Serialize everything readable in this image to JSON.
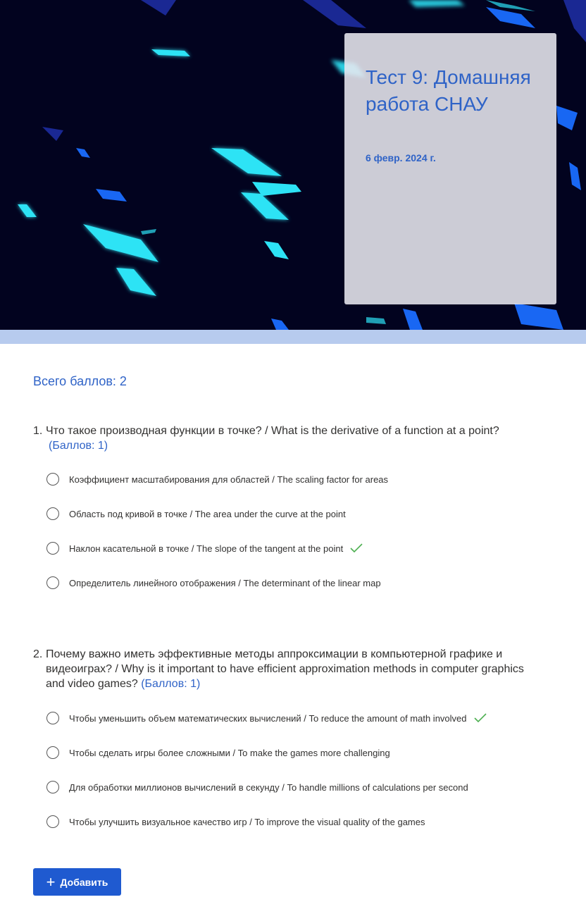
{
  "header": {
    "title": "Тест 9: Домашняя работа СНАУ",
    "date": "6 февр. 2024 г."
  },
  "total_points": "Всего баллов: 2",
  "questions": [
    {
      "number": "1.",
      "text": "Что такое производная функции в точке? / What is the derivative of a function at a point?",
      "points": "(Баллов: 1)",
      "options": [
        {
          "label": "Коэффициент масштабирования для областей / The scaling factor for areas",
          "correct": false
        },
        {
          "label": "Область под кривой в точке / The area under the curve at the point",
          "correct": false
        },
        {
          "label": "Наклон касательной в точке / The slope of the tangent at the point",
          "correct": true
        },
        {
          "label": "Определитель линейного отображения / The determinant of the linear map",
          "correct": false
        }
      ]
    },
    {
      "number": "2.",
      "text": "Почему важно иметь эффективные методы аппроксимации в компьютерной графике и видеоиграх? / Why is it important to have efficient approximation methods in computer graphics and video games?",
      "points": "(Баллов: 1)",
      "options": [
        {
          "label": "Чтобы уменьшить объем математических вычислений / To reduce the amount of math involved",
          "correct": true
        },
        {
          "label": "Чтобы сделать игры более сложными / To make the games more challenging",
          "correct": false
        },
        {
          "label": "Для обработки миллионов вычислений в секунду / To handle millions of calculations per second",
          "correct": false
        },
        {
          "label": "Чтобы улучшить визуальное качество игр / To improve the visual quality of the games",
          "correct": false
        }
      ]
    }
  ],
  "add_button": {
    "icon": "plus-icon",
    "label": "Добавить"
  },
  "colors": {
    "accent": "#2f63c7",
    "button": "#1f5ad0",
    "correct": "#4caf50",
    "banner_bg": "#02031f",
    "stripe": "#b7cbee"
  }
}
